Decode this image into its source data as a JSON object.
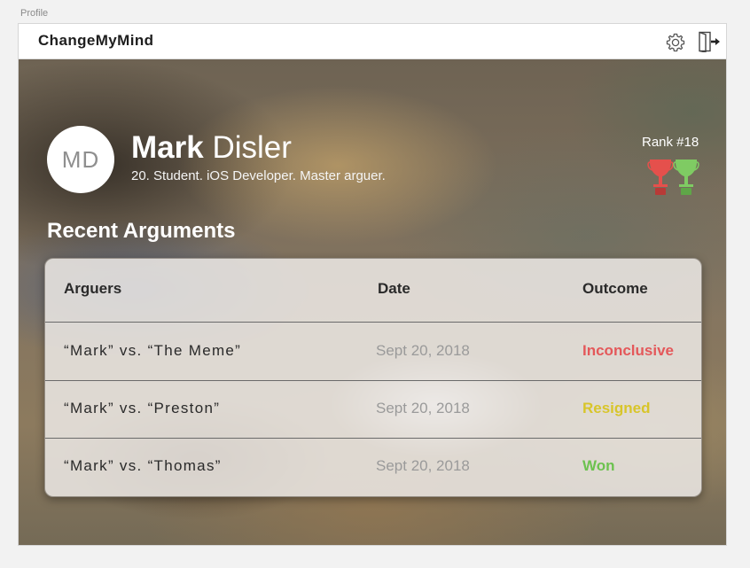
{
  "artboard_label": "Profile",
  "app": {
    "brand": "ChangeMyMind"
  },
  "profile": {
    "initials": "MD",
    "first_name": "Mark",
    "last_name": "Disler",
    "bio": "20. Student. iOS Developer. Master arguer.",
    "rank": "Rank #18",
    "trophies": [
      {
        "icon": "trophy-icon",
        "color": "#e5504c"
      },
      {
        "icon": "trophy-icon",
        "color": "#7fcb63"
      }
    ]
  },
  "recent": {
    "title": "Recent Arguments",
    "headers": {
      "arguers": "Arguers",
      "date": "Date",
      "outcome": "Outcome"
    },
    "rows": [
      {
        "arguers": "“Mark” vs. “The Meme”",
        "date": "Sept 20, 2018",
        "outcome": "Inconclusive",
        "outcome_color": "#e4585a"
      },
      {
        "arguers": "“Mark” vs. “Preston”",
        "date": "Sept 20, 2018",
        "outcome": "Resigned",
        "outcome_color": "#d8c52a"
      },
      {
        "arguers": "“Mark” vs. “Thomas”",
        "date": "Sept 20, 2018",
        "outcome": "Won",
        "outcome_color": "#6cc24f"
      }
    ]
  },
  "icons": {
    "settings": "gear-icon",
    "logout": "logout-icon"
  }
}
